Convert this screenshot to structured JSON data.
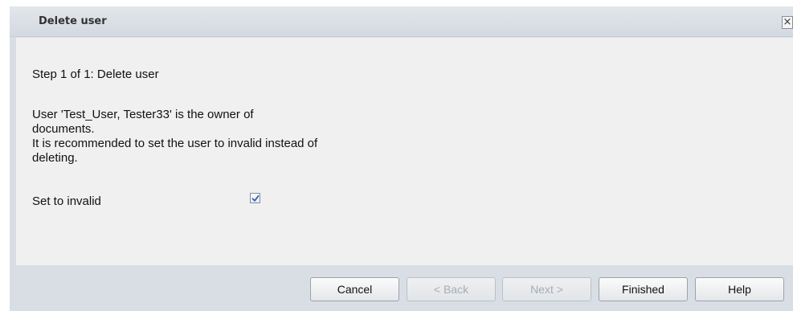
{
  "dialog": {
    "title": "Delete user",
    "close_glyph": "×"
  },
  "content": {
    "step": "Step 1 of 1: Delete user",
    "message_lines": [
      "User 'Test_User, Tester33' is the owner of",
      "documents.",
      "It is recommended to set the user to invalid instead of",
      "deleting."
    ],
    "option_label": "Set to invalid",
    "option_checked": true
  },
  "footer": {
    "buttons": [
      {
        "label": "Cancel",
        "enabled": true
      },
      {
        "label": "< Back",
        "enabled": false
      },
      {
        "label": "Next >",
        "enabled": false
      },
      {
        "label": "Finished",
        "enabled": true
      },
      {
        "label": "Help",
        "enabled": true
      }
    ]
  },
  "colors": {
    "dialog_background": "#d9dee5",
    "content_background": "#f0f0f0",
    "checkmark": "#3b5fa8"
  },
  "icons": {
    "close": "close-icon",
    "check": "checkmark-icon"
  }
}
